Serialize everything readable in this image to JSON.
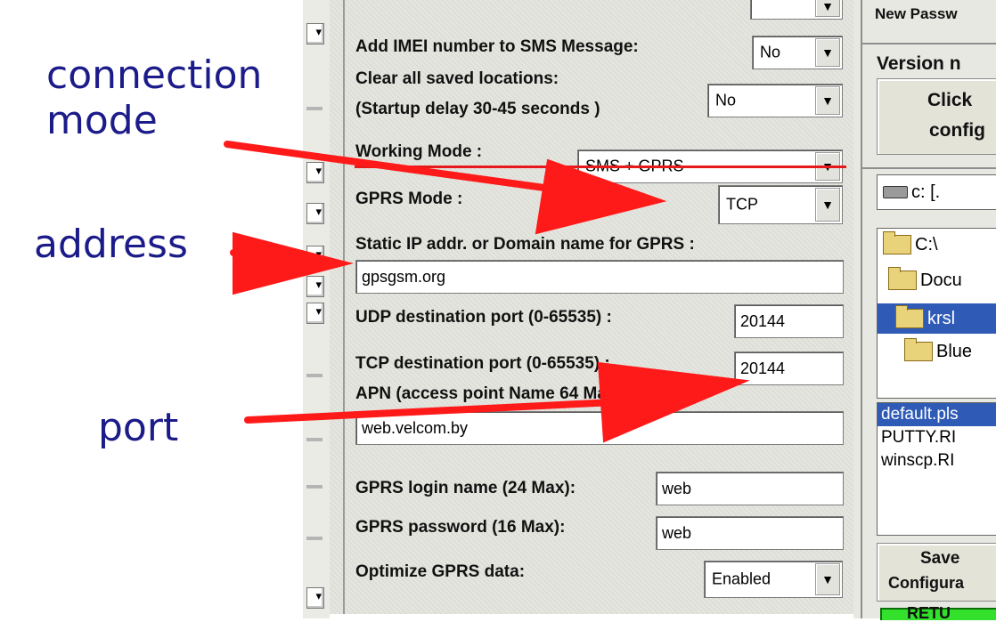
{
  "annotations": {
    "connection_mode": [
      "connection",
      "mode"
    ],
    "address": "address",
    "port": "port"
  },
  "settings": {
    "imei": {
      "label": "Add IMEI number to SMS Message:",
      "value": "No"
    },
    "clear_locations": {
      "label1": "Clear all saved locations:",
      "label2": "(Startup delay 30-45 seconds )",
      "value": "No"
    },
    "working_mode": {
      "label": "Working Mode :",
      "value": "SMS + GPRS"
    },
    "gprs_mode": {
      "label": "GPRS Mode :",
      "value": "TCP"
    },
    "static_ip": {
      "label": "Static IP addr. or Domain name for GPRS :",
      "value": "gpsgsm.org"
    },
    "udp_port": {
      "label": "UDP destination port (0-65535) :",
      "value": "20144"
    },
    "tcp_port": {
      "label": "TCP destination port (0-65535) :",
      "value": "20144"
    },
    "apn": {
      "label": "APN (access point Name 64 Max):",
      "value": "web.velcom.by"
    },
    "login": {
      "label": "GPRS login name (24 Max):",
      "value": "web"
    },
    "password": {
      "label": "GPRS password  (16 Max):",
      "value": "web"
    },
    "optimize": {
      "label": "Optimize GPRS data:",
      "value": "Enabled"
    }
  },
  "right_panel": {
    "new_password_label": "New Passw",
    "version_label": "Version n",
    "click_button": [
      "Click",
      "config"
    ],
    "drive": "c: [.",
    "tree": [
      "C:\\",
      "Docu",
      "krsl",
      "Blue"
    ],
    "files": [
      "default.pls",
      "PUTTY.RI",
      "winscp.RI"
    ],
    "save_button": [
      "Save",
      "Configura"
    ],
    "return_button": "RETU"
  },
  "colors": {
    "arrow": "#ff1a1a",
    "annotation_text": "#1b1b8a",
    "selection": "#2f5bb6",
    "return_green": "#33e02b"
  }
}
